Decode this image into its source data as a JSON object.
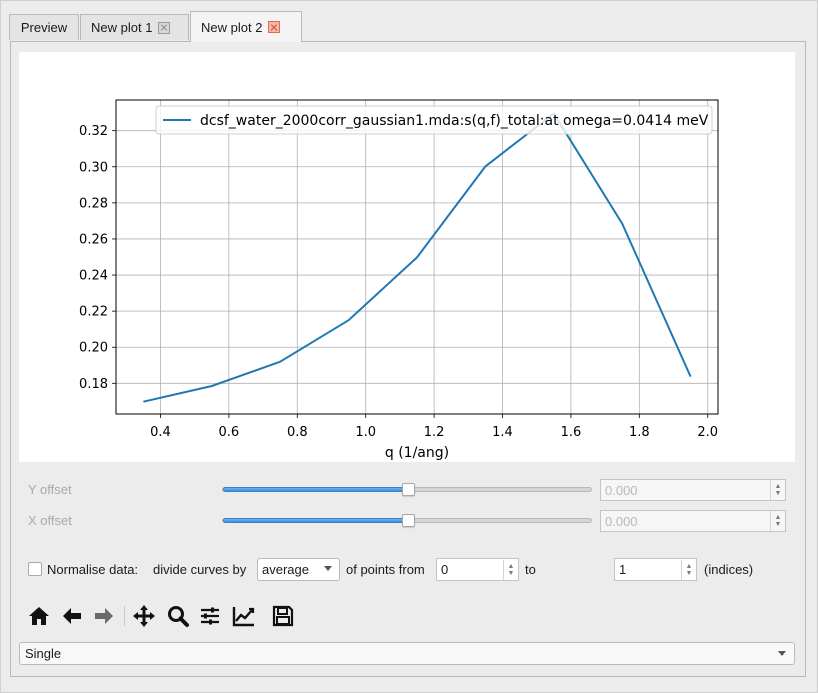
{
  "tabs": [
    {
      "label": "Preview"
    },
    {
      "label": "New plot 1"
    },
    {
      "label": "New plot 2"
    }
  ],
  "chart_data": {
    "type": "line",
    "title": "",
    "xlabel": "q (1/ang)",
    "ylabel": "",
    "xlim": [
      0.27,
      2.03
    ],
    "ylim": [
      0.163,
      0.337
    ],
    "xticks": [
      0.4,
      0.6,
      0.8,
      1.0,
      1.2,
      1.4,
      1.6,
      1.8,
      2.0
    ],
    "yticks": [
      0.18,
      0.2,
      0.22,
      0.24,
      0.26,
      0.28,
      0.3,
      0.32
    ],
    "xtick_labels": [
      "0.4",
      "0.6",
      "0.8",
      "1.0",
      "1.2",
      "1.4",
      "1.6",
      "1.8",
      "2.0"
    ],
    "ytick_labels": [
      "0.18",
      "0.20",
      "0.22",
      "0.24",
      "0.26",
      "0.28",
      "0.30",
      "0.32"
    ],
    "grid": true,
    "legend_position": "top-right",
    "series": [
      {
        "name": "dcsf_water_2000corr_gaussian1.mda:s(q,f)_total:at omega=0.0414 meV",
        "color": "#1f77b4",
        "x": [
          0.35,
          0.55,
          0.75,
          0.95,
          1.15,
          1.35,
          1.55,
          1.75,
          1.95
        ],
        "y": [
          0.1698,
          0.1785,
          0.192,
          0.215,
          0.2498,
          0.3002,
          0.3295,
          0.2685,
          0.1837
        ]
      }
    ]
  },
  "offsets": {
    "y_label": "Y offset",
    "x_label": "X offset",
    "y_value": "0.000",
    "x_value": "0.000",
    "y_slider_level": 0.5,
    "x_slider_level": 0.5
  },
  "normalise": {
    "checkbox_label": "Normalise data:",
    "checked": false,
    "divide_label": "divide curves by",
    "method": "average",
    "points_from_label": "of points from",
    "from_value": "0",
    "to_label": "to",
    "to_value": "1",
    "indices_label": "(indices)"
  },
  "toolbar": {
    "icons": [
      "home-icon",
      "back-arrow-icon",
      "forward-arrow-icon",
      "pan-icon",
      "zoom-icon",
      "configure-subplots-icon",
      "edit-axis-icon",
      "save-icon"
    ]
  },
  "plot_mode": {
    "selected": "Single"
  },
  "colors": {
    "line": "#1f77b4",
    "slider_fill": "#3f8ee0",
    "active_tab_close": "#e06b4f"
  }
}
